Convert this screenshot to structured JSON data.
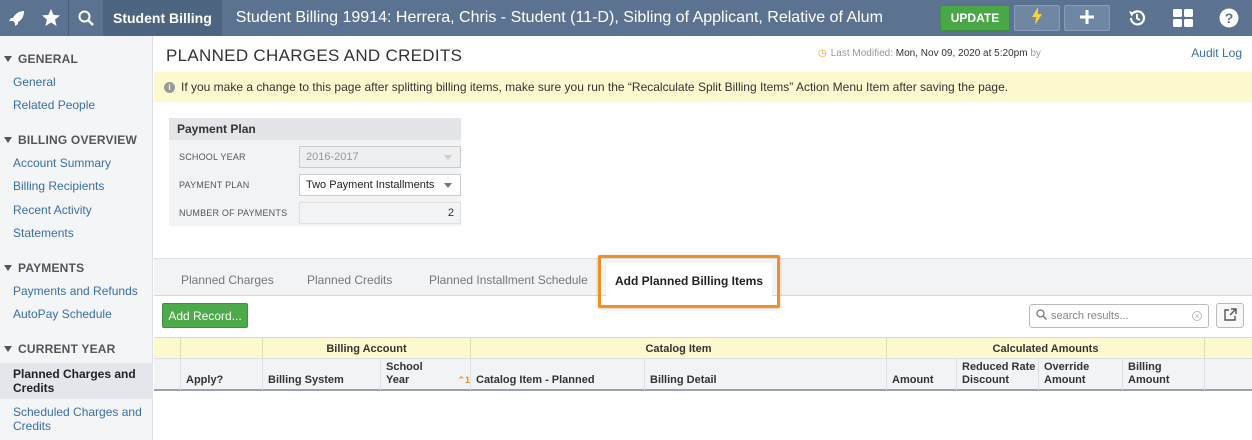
{
  "topbar": {
    "breadcrumb": "Student Billing",
    "title": "Student Billing 19914: Herrera, Chris - Student (11-D), Sibling of Applicant, Relative of Alum",
    "update_label": "UPDATE",
    "icons": [
      "rocket-icon",
      "star-icon",
      "search-icon",
      "lightning-icon",
      "plus-icon",
      "history-icon",
      "grid-icon",
      "help-icon"
    ]
  },
  "sidebar": {
    "sections": [
      {
        "title": "GENERAL",
        "items": [
          "General",
          "Related People"
        ]
      },
      {
        "title": "BILLING OVERVIEW",
        "items": [
          "Account Summary",
          "Billing Recipients",
          "Recent Activity",
          "Statements"
        ]
      },
      {
        "title": "PAYMENTS",
        "items": [
          "Payments and Refunds",
          "AutoPay Schedule"
        ]
      },
      {
        "title": "CURRENT YEAR",
        "items": [
          "Planned Charges and Credits",
          "Scheduled Charges and Credits"
        ]
      }
    ]
  },
  "page": {
    "title": "PLANNED CHARGES AND CREDITS",
    "last_modified_label": "Last Modified:",
    "last_modified_value": "Mon, Nov 09, 2020 at 5:20pm",
    "by_label": "by",
    "audit_log": "Audit Log",
    "banner": "If you make a change to this page after splitting billing items, make sure you run the “Recalculate Split Billing Items” Action Menu Item after saving the page."
  },
  "payment_plan": {
    "heading": "Payment Plan",
    "school_year_label": "SCHOOL YEAR",
    "school_year_value": "2016-2017",
    "plan_label": "PAYMENT PLAN",
    "plan_value": "Two Payment Installments",
    "num_payments_label": "NUMBER OF PAYMENTS",
    "num_payments_value": "2"
  },
  "tabs": {
    "items": [
      "Planned Charges",
      "Planned Credits",
      "Planned Installment Schedule",
      "Add Planned Billing Items"
    ],
    "active": "Add Planned Billing Items"
  },
  "toolbar": {
    "add_record": "Add Record...",
    "search_placeholder": "search results..."
  },
  "table": {
    "groups": [
      "Billing Account",
      "Catalog Item",
      "Calculated Amounts"
    ],
    "columns": [
      "Apply?",
      "Billing System",
      "School Year",
      "Catalog Item - Planned",
      "Billing Detail",
      "Amount",
      "Reduced Rate Discount",
      "Override Amount",
      "Billing Amount"
    ],
    "sort_indicator": "1"
  },
  "colors": {
    "topbar": "#5b7390",
    "update_green": "#49a748",
    "banner_yellow": "#fdf9cf",
    "highlight_orange": "#f0901e",
    "link_blue": "#3a6fa6"
  }
}
